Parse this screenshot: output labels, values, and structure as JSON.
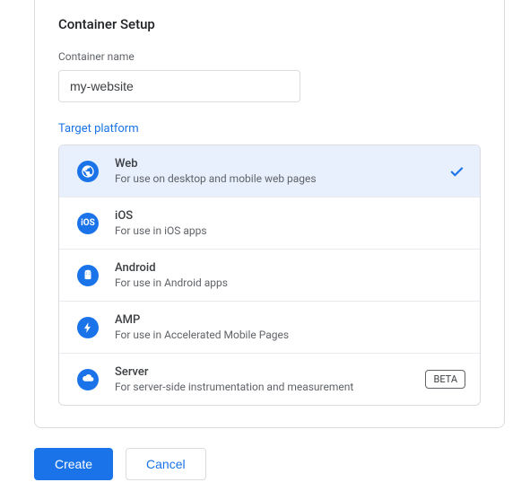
{
  "section": {
    "title": "Container Setup",
    "name_label": "Container name",
    "name_value": "my-website",
    "target_label": "Target platform"
  },
  "platforms": [
    {
      "name": "Web",
      "desc": "For use on desktop and mobile web pages",
      "selected": true
    },
    {
      "name": "iOS",
      "desc": "For use in iOS apps"
    },
    {
      "name": "Android",
      "desc": "For use in Android apps"
    },
    {
      "name": "AMP",
      "desc": "For use in Accelerated Mobile Pages"
    },
    {
      "name": "Server",
      "desc": "For server-side instrumentation and measurement",
      "badge": "BETA"
    }
  ],
  "actions": {
    "create": "Create",
    "cancel": "Cancel"
  }
}
